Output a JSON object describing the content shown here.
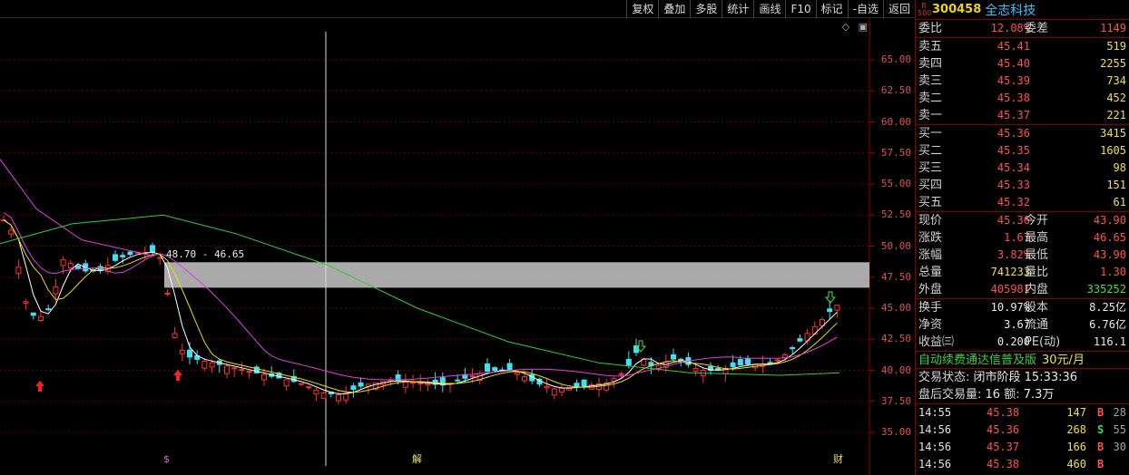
{
  "toolbar": [
    "复权",
    "叠加",
    "多股",
    "统计",
    "画线",
    "F10",
    "标记",
    "-自选",
    "返回"
  ],
  "chart": {
    "price_axis": [
      "65.00",
      "62.50",
      "60.00",
      "57.50",
      "55.00",
      "52.50",
      "50.00",
      "47.50",
      "45.00",
      "42.50",
      "40.00",
      "37.50",
      "35.00"
    ],
    "zone_label": "48.70 - 46.65",
    "markers": [
      "$",
      "解",
      "财"
    ],
    "colors": {
      "up": "#ff3030",
      "down": "#40e0f0",
      "ma5": "#ffffff",
      "ma10": "#e8e000",
      "ma20": "#e040e0",
      "ma60": "#30d030",
      "zone": "#c8c8c8"
    }
  },
  "panel": {
    "r_tag": "R\n500",
    "code": "300458",
    "name": "全志科技",
    "weibi": {
      "label": "委比",
      "value": "12.08%",
      "label2": "委差",
      "value2": "1149"
    },
    "asks": [
      {
        "label": "卖五",
        "price": "45.41",
        "vol": "519"
      },
      {
        "label": "卖四",
        "price": "45.40",
        "vol": "2255"
      },
      {
        "label": "卖三",
        "price": "45.39",
        "vol": "734"
      },
      {
        "label": "卖二",
        "price": "45.38",
        "vol": "452"
      },
      {
        "label": "卖一",
        "price": "45.37",
        "vol": "221"
      }
    ],
    "bids": [
      {
        "label": "买一",
        "price": "45.36",
        "vol": "3415"
      },
      {
        "label": "买二",
        "price": "45.35",
        "vol": "1605"
      },
      {
        "label": "买三",
        "price": "45.34",
        "vol": "98"
      },
      {
        "label": "买四",
        "price": "45.33",
        "vol": "151"
      },
      {
        "label": "买五",
        "price": "45.32",
        "vol": "61"
      }
    ],
    "stats1": [
      {
        "l1": "现价",
        "v1": "45.36",
        "c1": "red",
        "l2": "今开",
        "v2": "43.90",
        "c2": "red"
      },
      {
        "l1": "涨跌",
        "v1": "1.67",
        "c1": "red",
        "l2": "最高",
        "v2": "46.65",
        "c2": "red"
      },
      {
        "l1": "涨幅",
        "v1": "3.82%",
        "c1": "red",
        "l2": "最低",
        "v2": "43.90",
        "c2": "red"
      },
      {
        "l1": "总量",
        "v1": "741233",
        "c1": "yellow",
        "l2": "量比",
        "v2": "1.30",
        "c2": "red"
      },
      {
        "l1": "外盘",
        "v1": "405981",
        "c1": "red",
        "l2": "内盘",
        "v2": "335252",
        "c2": "green"
      }
    ],
    "stats2": [
      {
        "l1": "换手",
        "v1": "10.97%",
        "c1": "white",
        "l2": "股本",
        "v2": "8.25亿",
        "c2": "white"
      },
      {
        "l1": "净资",
        "v1": "3.67",
        "c1": "white",
        "l2": "流通",
        "v2": "6.76亿",
        "c2": "white"
      },
      {
        "l1": "收益㈢",
        "v1": "0.200",
        "c1": "white",
        "l2": "PE(动)",
        "v2": "116.1",
        "c2": "white"
      }
    ],
    "promo": {
      "text": "自动续费通达信普及版",
      "price": "30元/月"
    },
    "status": {
      "label": "交易状态:",
      "value": "闭市阶段 15:33:36"
    },
    "after_hours": {
      "label": "盘后交易量:",
      "vol": "16",
      "amt_label": "额:",
      "amt": "7.3万"
    },
    "ticks": [
      {
        "time": "14:55",
        "price": "45.38",
        "qty": "147",
        "side": "B",
        "n": "28"
      },
      {
        "time": "14:56",
        "price": "45.36",
        "qty": "268",
        "side": "S",
        "n": "55"
      },
      {
        "time": "14:56",
        "price": "45.37",
        "qty": "166",
        "side": "B",
        "n": "30"
      },
      {
        "time": "14:56",
        "price": "45.38",
        "qty": "460",
        "side": "B",
        "n": ""
      }
    ]
  }
}
